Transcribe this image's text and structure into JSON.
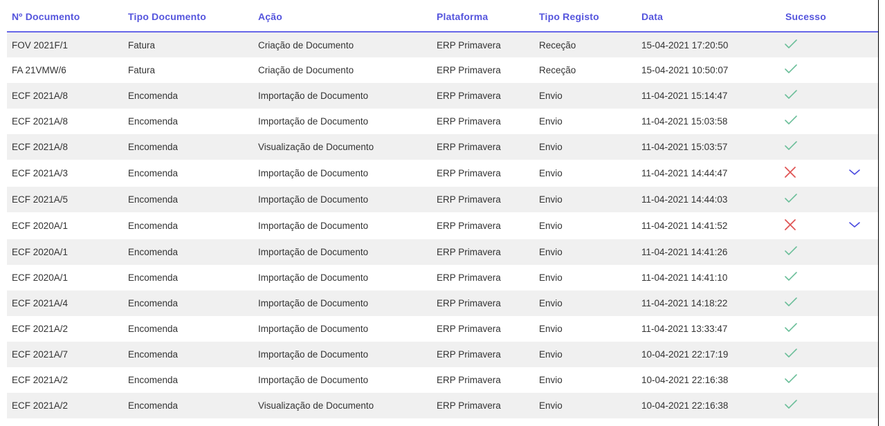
{
  "colors": {
    "header_text": "#5555dd",
    "header_border": "#6666e8",
    "success": "#6cbf9a",
    "failure": "#e05555",
    "chevron": "#4a4ae0",
    "row_alt": "#f0f0f0"
  },
  "table": {
    "headers": [
      "Nº Documento",
      "Tipo Documento",
      "Ação",
      "Plataforma",
      "Tipo Registo",
      "Data",
      "Sucesso"
    ],
    "rows": [
      {
        "doc": "FOV 2021F/1",
        "tipo": "Fatura",
        "acao": "Criação de Documento",
        "plataforma": "ERP Primavera",
        "registo": "Receção",
        "data": "15-04-2021 17:20:50",
        "sucesso": "check-icon",
        "expand": false
      },
      {
        "doc": "FA 21VMW/6",
        "tipo": "Fatura",
        "acao": "Criação de Documento",
        "plataforma": "ERP Primavera",
        "registo": "Receção",
        "data": "15-04-2021 10:50:07",
        "sucesso": "check-icon",
        "expand": false
      },
      {
        "doc": "ECF 2021A/8",
        "tipo": "Encomenda",
        "acao": "Importação de Documento",
        "plataforma": "ERP Primavera",
        "registo": "Envio",
        "data": "11-04-2021 15:14:47",
        "sucesso": "check-icon",
        "expand": false
      },
      {
        "doc": "ECF 2021A/8",
        "tipo": "Encomenda",
        "acao": "Importação de Documento",
        "plataforma": "ERP Primavera",
        "registo": "Envio",
        "data": "11-04-2021 15:03:58",
        "sucesso": "check-icon",
        "expand": false
      },
      {
        "doc": "ECF 2021A/8",
        "tipo": "Encomenda",
        "acao": "Visualização de Documento",
        "plataforma": "ERP Primavera",
        "registo": "Envio",
        "data": "11-04-2021 15:03:57",
        "sucesso": "check-icon",
        "expand": false
      },
      {
        "doc": "ECF 2021A/3",
        "tipo": "Encomenda",
        "acao": "Importação de Documento",
        "plataforma": "ERP Primavera",
        "registo": "Envio",
        "data": "11-04-2021 14:44:47",
        "sucesso": "cross-icon",
        "expand": true
      },
      {
        "doc": "ECF 2021A/5",
        "tipo": "Encomenda",
        "acao": "Importação de Documento",
        "plataforma": "ERP Primavera",
        "registo": "Envio",
        "data": "11-04-2021 14:44:03",
        "sucesso": "check-icon",
        "expand": false
      },
      {
        "doc": "ECF 2020A/1",
        "tipo": "Encomenda",
        "acao": "Importação de Documento",
        "plataforma": "ERP Primavera",
        "registo": "Envio",
        "data": "11-04-2021 14:41:52",
        "sucesso": "cross-icon",
        "expand": true
      },
      {
        "doc": "ECF 2020A/1",
        "tipo": "Encomenda",
        "acao": "Importação de Documento",
        "plataforma": "ERP Primavera",
        "registo": "Envio",
        "data": "11-04-2021 14:41:26",
        "sucesso": "check-icon",
        "expand": false
      },
      {
        "doc": "ECF 2020A/1",
        "tipo": "Encomenda",
        "acao": "Importação de Documento",
        "plataforma": "ERP Primavera",
        "registo": "Envio",
        "data": "11-04-2021 14:41:10",
        "sucesso": "check-icon",
        "expand": false
      },
      {
        "doc": "ECF 2021A/4",
        "tipo": "Encomenda",
        "acao": "Importação de Documento",
        "plataforma": "ERP Primavera",
        "registo": "Envio",
        "data": "11-04-2021 14:18:22",
        "sucesso": "check-icon",
        "expand": false
      },
      {
        "doc": "ECF 2021A/2",
        "tipo": "Encomenda",
        "acao": "Importação de Documento",
        "plataforma": "ERP Primavera",
        "registo": "Envio",
        "data": "11-04-2021 13:33:47",
        "sucesso": "check-icon",
        "expand": false
      },
      {
        "doc": "ECF 2021A/7",
        "tipo": "Encomenda",
        "acao": "Importação de Documento",
        "plataforma": "ERP Primavera",
        "registo": "Envio",
        "data": "10-04-2021 22:17:19",
        "sucesso": "check-icon",
        "expand": false
      },
      {
        "doc": "ECF 2021A/2",
        "tipo": "Encomenda",
        "acao": "Importação de Documento",
        "plataforma": "ERP Primavera",
        "registo": "Envio",
        "data": "10-04-2021 22:16:38",
        "sucesso": "check-icon",
        "expand": false
      },
      {
        "doc": "ECF 2021A/2",
        "tipo": "Encomenda",
        "acao": "Visualização de Documento",
        "plataforma": "ERP Primavera",
        "registo": "Envio",
        "data": "10-04-2021 22:16:38",
        "sucesso": "check-icon",
        "expand": false
      }
    ]
  }
}
